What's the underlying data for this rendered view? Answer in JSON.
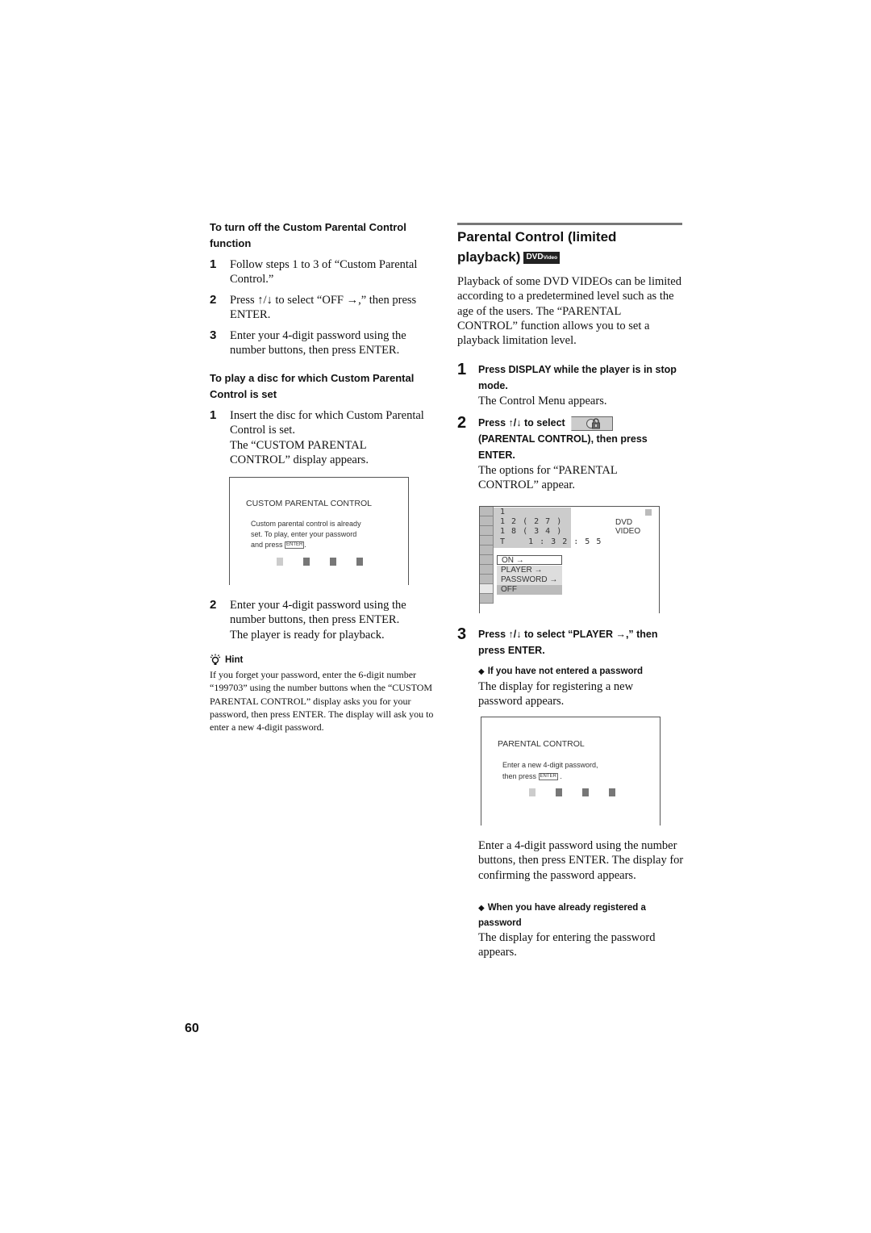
{
  "left": {
    "section1": {
      "heading": "To turn off the Custom Parental Control function",
      "steps": [
        {
          "num": "1",
          "text": "Follow steps 1 to 3 of “Custom Parental Control.”"
        },
        {
          "num": "2",
          "text": "Press ↑/↓ to select “OFF →,” then press ENTER."
        },
        {
          "num": "3",
          "text": "Enter your 4-digit password using the number buttons, then press ENTER."
        }
      ]
    },
    "section2": {
      "heading": "To play a disc for which Custom Parental Control is set",
      "steps": [
        {
          "num": "1",
          "text": "Insert the disc for which Custom Parental Control is set.",
          "note": "The “CUSTOM PARENTAL CONTROL” display appears."
        },
        {
          "num": "2",
          "text": "Enter your 4-digit password using the number buttons, then press ENTER.",
          "note": "The player is ready for playback."
        }
      ],
      "screen": {
        "title": "CUSTOM PARENTAL CONTROL",
        "message_line1": "Custom parental control is already",
        "message_line2": "set. To play, enter your password",
        "message_line3": "and press",
        "enter_key": "ENTER",
        "message_end": "."
      }
    },
    "hint": {
      "label": "Hint",
      "text": "If you forget your password, enter the 6-digit number “199703” using the number buttons when the “CUSTOM PARENTAL CONTROL” display asks you for your password, then press ENTER. The display will ask you to enter a new 4-digit password."
    }
  },
  "right": {
    "title_line1": "Parental Control (limited",
    "title_line2": "playback)",
    "badge_main": "DVD",
    "badge_sub": "Video",
    "intro": "Playback of some DVD VIDEOs can be limited according to a predetermined level such as the age of the users. The “PARENTAL CONTROL” function allows you to set a playback limitation level.",
    "steps": [
      {
        "num": "1",
        "head": "Press DISPLAY while the player is in stop mode.",
        "sub": "The Control Menu appears."
      },
      {
        "num": "2",
        "head_pre": "Press ↑/↓ to select",
        "head_post": "(PARENTAL CONTROL), then press ENTER.",
        "sub": "The options for “PARENTAL CONTROL” appear."
      },
      {
        "num": "3",
        "head": "Press ↑/↓ to select “PLAYER →,” then press ENTER."
      }
    ],
    "menu_screen": {
      "info_lines": [
        "1",
        "1 2 ( 2 7 )",
        "1 8 ( 3 4 )",
        "T    1 : 3 2 : 5 5"
      ],
      "disc_type": "DVD VIDEO",
      "options": [
        "ON →",
        "PLAYER →",
        "PASSWORD →",
        "OFF"
      ],
      "selected_option": "ON →"
    },
    "case1": {
      "heading": "If you have not entered a password",
      "text": "The display for registering a new password appears.",
      "screen": {
        "title": "PARENTAL CONTROL",
        "message_line1": "Enter a new 4-digit password,",
        "message_line2": "then press",
        "enter_key": "ENTER",
        "message_end": "."
      },
      "after": "Enter a 4-digit password using the number buttons, then press ENTER. The display for confirming the password appears."
    },
    "case2": {
      "heading": "When you have already registered a password",
      "text": "The display for entering the password appears."
    }
  },
  "page_number": "60"
}
